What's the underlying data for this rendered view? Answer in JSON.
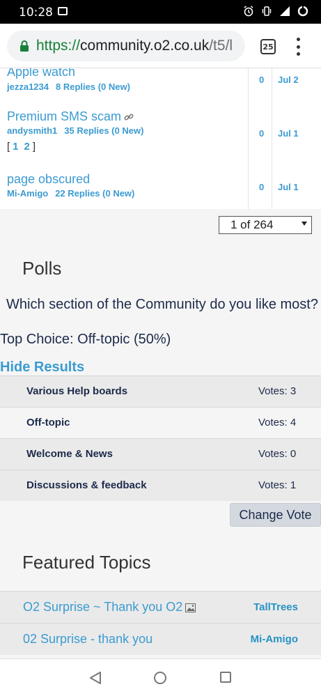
{
  "status_bar": {
    "time": "10:28",
    "icons": [
      "image-icon",
      "alarm-icon",
      "vibrate-icon",
      "signal-icon",
      "battery-icon"
    ]
  },
  "browser": {
    "url_scheme": "https://",
    "url_host": "community.o2.co.uk",
    "url_path": "/t5/l",
    "tab_count": "25"
  },
  "topics": [
    {
      "title": "Apple watch",
      "author": "jezza1234",
      "replies": "8 Replies (0 New)",
      "count": "0",
      "date": "Jul 2",
      "has_link_icon": false
    },
    {
      "title": "Premium SMS scam",
      "author": "andysmith1",
      "replies": "35 Replies (0 New)",
      "pages_open": "[",
      "page1": "1",
      "page2": "2",
      "pages_close": "]",
      "count": "0",
      "date": "Jul 1",
      "has_link_icon": true
    },
    {
      "title": "page obscured",
      "author": "Mi-Amigo",
      "replies": "22 Replies (0 New)",
      "count": "0",
      "date": "Jul 1",
      "has_link_icon": false
    }
  ],
  "pager": {
    "value": "1 of 264"
  },
  "polls": {
    "heading": "Polls",
    "question": "Which section of the Community do you like most?",
    "top_choice": "Top Choice: Off-topic (50%)",
    "hide_results": "Hide Results",
    "options": [
      {
        "label": "Various Help boards",
        "votes": "Votes: 3"
      },
      {
        "label": "Off-topic",
        "votes": "Votes: 4"
      },
      {
        "label": "Welcome & News",
        "votes": "Votes: 0"
      },
      {
        "label": "Discussions & feedback",
        "votes": "Votes: 1"
      }
    ],
    "change_vote": "Change Vote"
  },
  "featured": {
    "heading": "Featured Topics",
    "items": [
      {
        "title": "O2 Surprise ~ Thank you O2",
        "author": "TallTrees",
        "has_image_icon": true
      },
      {
        "title": "02 Surprise - thank you",
        "author": "Mi-Amigo",
        "has_image_icon": false
      }
    ]
  },
  "colors": {
    "link": "#3b9bd1",
    "text_dark": "#1c2a4a",
    "https_green": "#188038"
  }
}
